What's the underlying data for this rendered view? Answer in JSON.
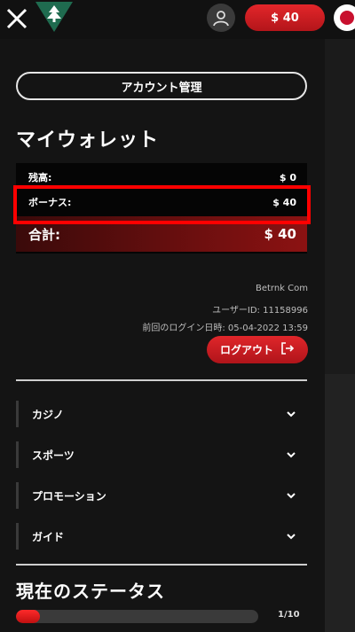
{
  "header": {
    "balance_label": "$ 40",
    "icons": [
      "close-icon",
      "tree-logo-icon",
      "user-icon",
      "flag-icon"
    ]
  },
  "account": {
    "manage_button": "アカウント管理"
  },
  "wallet": {
    "title": "マイウォレット",
    "balance_label": "残高:",
    "balance_value": "$ 0",
    "bonus_label": "ボーナス:",
    "bonus_value": "$ 40",
    "total_label": "合計:",
    "total_value": "$ 40"
  },
  "user_info": {
    "site": "Betrnk Com",
    "user_id": "ユーザーID: 11158996",
    "last_login": "前回のログイン日時: 05-04-2022 13:59"
  },
  "logout_button": "ログアウト",
  "nav": {
    "items": [
      {
        "label": "カジノ"
      },
      {
        "label": "スポーツ"
      },
      {
        "label": "プロモーション"
      },
      {
        "label": "ガイド"
      }
    ]
  },
  "status": {
    "title": "現在のステータス",
    "progress_label": "1/10",
    "progress_fraction": 0.1
  },
  "colors": {
    "accent_red": "#d81e23",
    "highlight": "#ff0000",
    "background": "#141414"
  }
}
